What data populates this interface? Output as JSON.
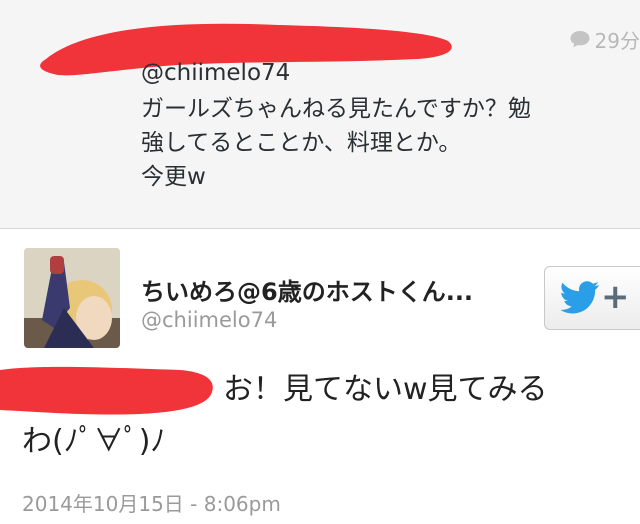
{
  "reply": {
    "time": "29分",
    "handle": "@chiimelo74",
    "lines": [
      "ガールズちゃんねる見たんですか？勉",
      "強してるとことか、料理とか。",
      "今更w"
    ]
  },
  "tweet": {
    "display_name": "ちいめろ@6歳のホストくん...",
    "handle": "@chiimelo74",
    "text_line1": "お！見てないw見てみる",
    "text_line2": "わ(ﾉﾟ∀ﾟ)ﾉ",
    "timestamp": "2014年10月15日 - 8:06pm"
  },
  "follow_button": {
    "label": "+"
  },
  "colors": {
    "redaction": "#f0343a",
    "twitter_blue": "#2a9fe8",
    "reply_background": "#f5f5f5"
  },
  "icons": {
    "bubble": "speech-bubble-icon",
    "bird": "twitter-bird-icon"
  }
}
